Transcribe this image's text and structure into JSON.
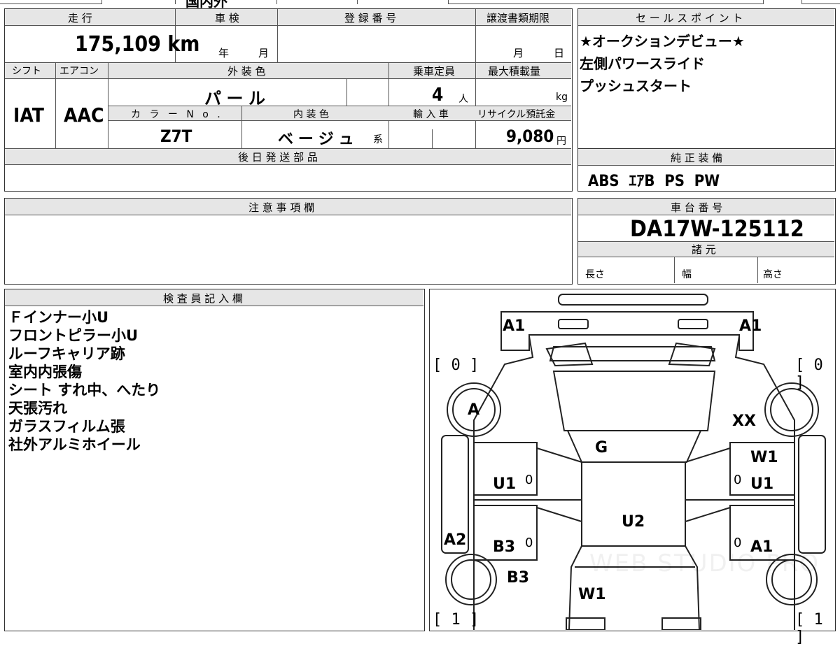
{
  "top_fragment": "国内外",
  "main_table": {
    "mileage_label": "走 行",
    "mileage_value": "175,109",
    "mileage_unit": "km",
    "shaken_label": "車 検",
    "shaken_year": "年",
    "shaken_month": "月",
    "reg_label": "登 録 番 号",
    "transfer_label": "譲渡書類期限",
    "transfer_month": "月",
    "transfer_day": "日",
    "shift_label": "シフト",
    "shift_value": "IAT",
    "ac_label": "エアコン",
    "ac_value": "AAC",
    "ext_color_label": "外 装 色",
    "ext_color_value": "パ ー ル",
    "capacity_label": "乗車定員",
    "capacity_value": "4",
    "capacity_unit": "人",
    "max_load_label": "最大積載量",
    "max_load_unit": "kg",
    "color_no_label": "カ ラ ー N o .",
    "color_no_value": "Z7T",
    "int_color_label": "内 装 色",
    "int_color_value": "ベ ー ジ ュ",
    "int_color_suffix": "系",
    "import_label": "輸 入 車",
    "recycle_label": "リサイクル預託金",
    "recycle_value": "9,080",
    "recycle_unit": "円",
    "later_parts_label": "後 日 発 送 部 品"
  },
  "sales_points": {
    "label": "セ ー ル ス ポ イ ン ト",
    "lines": [
      "★オークションデビュー★",
      "左側パワースライド",
      "プッシュスタート"
    ]
  },
  "equipment": {
    "label": "純 正 装 備",
    "value": "ABS  ｴｱB  PS  PW"
  },
  "notes": {
    "label": "注 意 事 項 欄"
  },
  "chassis": {
    "label": "車 台 番 号",
    "value": "DA17W-125112",
    "specs_label": "諸 元",
    "length_label": "長さ",
    "width_label": "幅",
    "height_label": "高さ"
  },
  "inspector": {
    "label": "検 査 員 記 入 欄",
    "lines": [
      "Ｆインナー小U",
      "フロントピラー小U",
      "ルーフキャリア跡",
      "室内内張傷",
      "シート すれ中、へたり",
      "天張汚れ",
      "ガラスフィルム張",
      "社外アルミホイール"
    ]
  },
  "diagram": {
    "bracket_tl": "[ 0 ]",
    "bracket_tr": "[ 0 ]",
    "bracket_bl": "[ 1 ]",
    "bracket_br": "[ 1 ]",
    "marks": {
      "a1_left": "A1",
      "a1_right": "A1",
      "a_front_wheel": "A",
      "xx": "XX",
      "g": "G",
      "w1_right": "W1",
      "u1_left": "U1",
      "u1_right": "U1",
      "zero_l1": "0",
      "zero_r1": "0",
      "u2": "U2",
      "a2": "A2",
      "b3_left": "B3",
      "zero_l2": "0",
      "zero_r2": "0",
      "a1_right_lower": "A1",
      "b3_rear": "B3",
      "w1_rear": "W1"
    },
    "watermark": "WEB STUDIO PRO"
  }
}
